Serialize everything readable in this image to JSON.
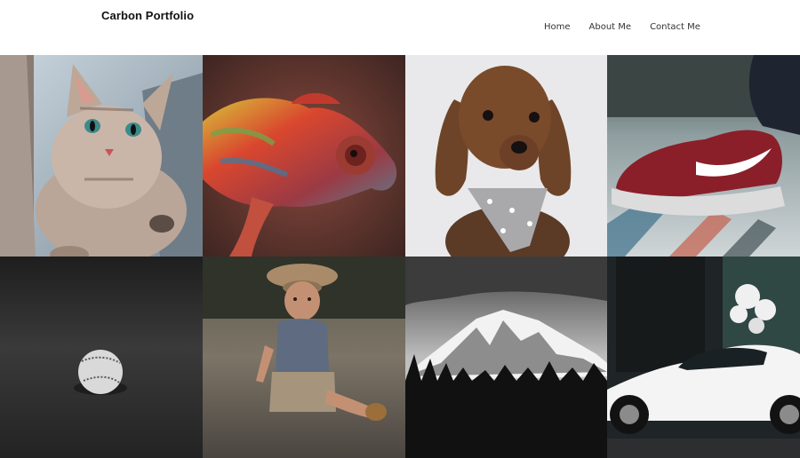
{
  "header": {
    "brand": "Carbon Portfolio"
  },
  "nav": {
    "items": [
      {
        "label": "Home"
      },
      {
        "label": "About Me"
      },
      {
        "label": "Contact Me"
      }
    ]
  },
  "gallery": {
    "tiles": [
      {
        "subject": "cat"
      },
      {
        "subject": "chameleon"
      },
      {
        "subject": "dog"
      },
      {
        "subject": "sneaker"
      },
      {
        "subject": "baseball"
      },
      {
        "subject": "child"
      },
      {
        "subject": "mountain"
      },
      {
        "subject": "car"
      }
    ]
  }
}
